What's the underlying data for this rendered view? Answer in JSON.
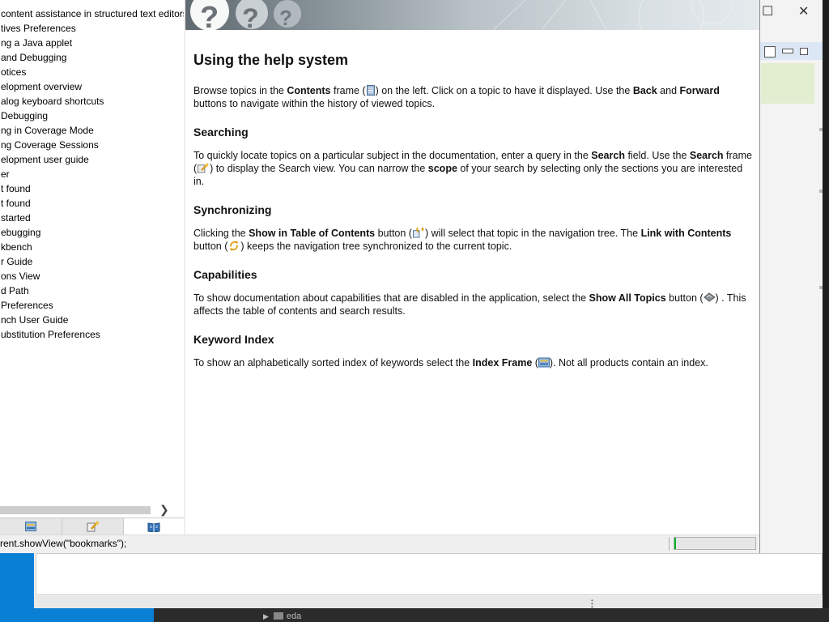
{
  "toc": {
    "items": [
      "content assistance in structured text editors",
      "tives Preferences",
      "ng a Java applet",
      " and Debugging",
      "otices",
      "elopment overview",
      "alog keyboard shortcuts",
      " Debugging",
      "ng in Coverage Mode",
      "ng Coverage Sessions",
      "elopment user guide",
      "er",
      "t found",
      "t found",
      "started",
      "ebugging",
      "kbench",
      "r Guide",
      "ons View",
      "d Path",
      " Preferences",
      "nch User Guide",
      "ubstitution Preferences"
    ]
  },
  "nav_tabs": [
    {
      "name": "index-frame",
      "icon": "index-icon"
    },
    {
      "name": "search-frame",
      "icon": "search-icon"
    },
    {
      "name": "contents-frame",
      "icon": "book-icon"
    }
  ],
  "doc": {
    "title": "Using the help system",
    "intro": {
      "a": "Browse topics in the ",
      "b": "Contents",
      "c": " frame (",
      "d": ") on the left. Click on a topic to have it displayed. Use the ",
      "e": "Back",
      "f": " and ",
      "g": "Forward",
      "h": " buttons to navigate within the history of viewed topics."
    },
    "searching": {
      "heading": "Searching",
      "a": "To quickly locate topics on a particular subject in the documentation, enter a query in the ",
      "b": "Search",
      "c": " field. Use the ",
      "d": "Search",
      "e": " frame (",
      "f": ") to display the Search view. You can narrow the ",
      "g": "scope",
      "h": " of your search by selecting only the sections you are interested in."
    },
    "synchronizing": {
      "heading": "Synchronizing",
      "a": "Clicking the ",
      "b": "Show in Table of Contents",
      "c": " button (",
      "d": ") will select that topic in the navigation tree. The ",
      "e": "Link with Contents",
      "f": " button (",
      "g": ") keeps the navigation tree synchronized to the current topic."
    },
    "capabilities": {
      "heading": "Capabilities",
      "a": "To show documentation about capabilities that are disabled in the application, select the ",
      "b": "Show All Topics",
      "c": " button (",
      "d": ") . This affects the table of contents and search results."
    },
    "keyword": {
      "heading": "Keyword Index",
      "a": "To show an alphabetically sorted index of keywords select the ",
      "b": "Index Frame",
      "c": " (",
      "d": "). Not all products contain an index."
    }
  },
  "status": {
    "text": "rent.showView(\"bookmarks\");",
    "progress": 0.02
  },
  "background": {
    "taskbar_item": "eda"
  },
  "colors": {
    "progress_green": "#06b025",
    "desktop_blue": "#0a7fd6"
  }
}
